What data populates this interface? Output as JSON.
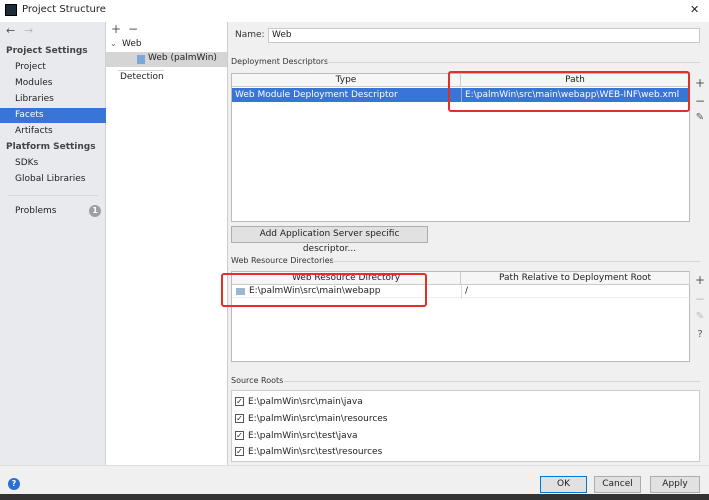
{
  "window": {
    "title": "Project Structure",
    "close": "✕"
  },
  "sidebar": {
    "back": "←",
    "forward": "→",
    "project_settings": "Project Settings",
    "items": [
      {
        "label": "Project"
      },
      {
        "label": "Modules"
      },
      {
        "label": "Libraries"
      },
      {
        "label": "Facets",
        "selected": true
      },
      {
        "label": "Artifacts"
      }
    ],
    "platform_settings": "Platform Settings",
    "platform_items": [
      {
        "label": "SDKs"
      },
      {
        "label": "Global Libraries"
      }
    ],
    "problems": "Problems",
    "problems_count": "1"
  },
  "middle": {
    "add": "+",
    "remove": "−",
    "group": "Web",
    "facet": "Web (palmWin)",
    "detection": "Detection"
  },
  "main": {
    "name_label": "Name:",
    "name_value": "Web",
    "deployment": {
      "title": "Deployment Descriptors",
      "columns": [
        "Type",
        "Path"
      ],
      "rows": [
        {
          "type": "Web Module Deployment Descriptor",
          "path": "E:\\palmWin\\src\\main\\webapp\\WEB-INF\\web.xml"
        }
      ]
    },
    "add_server_button": "Add Application Server specific descriptor...",
    "resources": {
      "title": "Web Resource Directories",
      "columns": [
        "Web Resource Directory",
        "Path Relative to Deployment Root"
      ],
      "rows": [
        {
          "dir": "E:\\palmWin\\src\\main\\webapp",
          "relative": "/"
        }
      ]
    },
    "source_roots": {
      "title": "Source Roots",
      "items": [
        {
          "label": "E:\\palmWin\\src\\main\\java",
          "checked": true
        },
        {
          "label": "E:\\palmWin\\src\\main\\resources",
          "checked": true
        },
        {
          "label": "E:\\palmWin\\src\\test\\java",
          "checked": true
        },
        {
          "label": "E:\\palmWin\\src\\test\\resources",
          "checked": true
        }
      ]
    }
  },
  "side_buttons": {
    "add": "+",
    "remove": "−",
    "edit": "✎",
    "help": "?"
  },
  "footer": {
    "ok": "OK",
    "cancel": "Cancel",
    "apply": "Apply",
    "help": "?"
  },
  "colors": {
    "selection": "#3875d7",
    "highlight": "#e0302a"
  }
}
